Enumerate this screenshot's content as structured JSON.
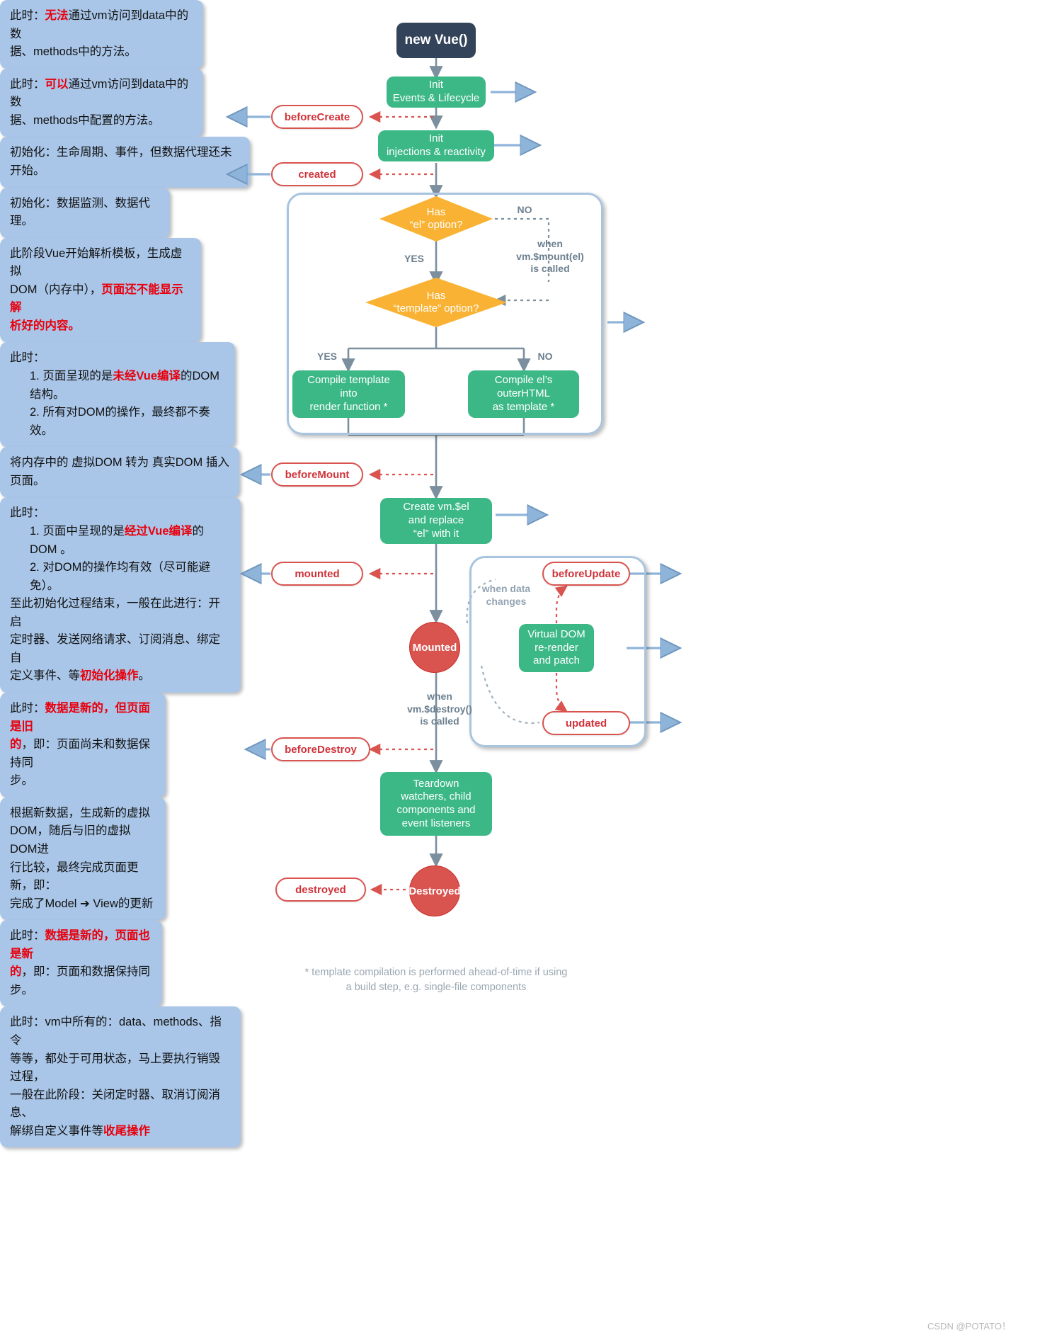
{
  "title": "Vue 生命周期 (Vue Lifecycle Diagram)",
  "nodes": {
    "new_vue": "new Vue()",
    "init_events": "Init\nEvents & Lifecycle",
    "init_injections": "Init\ninjections & reactivity",
    "has_el": "Has\n“el” option?",
    "has_template": "Has\n“template” option?",
    "compile_template": "Compile template\ninto\nrender function *",
    "compile_outer": "Compile el’s\nouterHTML\nas template *",
    "create_el": "Create vm.$el\nand replace\n“el” with it",
    "virtual_dom": "Virtual DOM\nre-render\nand patch",
    "teardown": "Teardown\nwatchers, child\ncomponents and\nevent listeners"
  },
  "hooks": {
    "before_create": "beforeCreate",
    "created": "created",
    "before_mount": "beforeMount",
    "mounted": "mounted",
    "before_update": "beforeUpdate",
    "updated": "updated",
    "before_destroy": "beforeDestroy",
    "destroyed": "destroyed"
  },
  "states": {
    "mounted": "Mounted",
    "destroyed": "Destroyed"
  },
  "edge_labels": {
    "no_1": "NO",
    "yes_1": "YES",
    "when_mount": "when\nvm.$mount(el)\nis called",
    "yes_2": "YES",
    "no_2": "NO",
    "when_data_changes": "when data\nchanges",
    "when_destroy": "when\nvm.$destroy()\nis called"
  },
  "notes": {
    "before_create": {
      "lines": [
        {
          "parts": [
            {
              "t": "此时："
            },
            {
              "t": "无法",
              "hl": true
            },
            {
              "t": "通过vm访问到data中的数"
            }
          ]
        },
        {
          "parts": [
            {
              "t": "据、methods中的方法。"
            }
          ]
        }
      ]
    },
    "created": {
      "lines": [
        {
          "parts": [
            {
              "t": "此时："
            },
            {
              "t": "可以",
              "hl": true
            },
            {
              "t": "通过vm访问到data中的数"
            }
          ]
        },
        {
          "parts": [
            {
              "t": "据、methods中配置的方法。"
            }
          ]
        }
      ]
    },
    "init_events": {
      "lines": [
        {
          "parts": [
            {
              "t": "初始化：生命周期、事件，但数据代理还未开始。"
            }
          ]
        }
      ]
    },
    "init_injections": {
      "lines": [
        {
          "parts": [
            {
              "t": "初始化：数据监测、数据代理。"
            }
          ]
        }
      ]
    },
    "compile_stage": {
      "lines": [
        {
          "parts": [
            {
              "t": "此阶段Vue开始解析模板，生成虚拟"
            }
          ]
        },
        {
          "parts": [
            {
              "t": "DOM（内存中），"
            },
            {
              "t": "页面还不能显示解",
              "hl": true
            }
          ]
        },
        {
          "parts": [
            {
              "t": "析好的内容。",
              "hl": true
            }
          ]
        }
      ]
    },
    "before_mount": {
      "lines": [
        {
          "parts": [
            {
              "t": "此时："
            }
          ]
        },
        {
          "indent": true,
          "parts": [
            {
              "t": "1. 页面呈现的是"
            },
            {
              "t": "未经Vue编译",
              "hl": true
            },
            {
              "t": "的DOM结构。"
            }
          ]
        },
        {
          "indent": true,
          "parts": [
            {
              "t": "2. 所有对DOM的操作，最终都不奏效。"
            }
          ]
        }
      ]
    },
    "create_el": {
      "lines": [
        {
          "parts": [
            {
              "t": "将内存中的 虚拟DOM 转为 真实DOM 插入页面。"
            }
          ]
        }
      ]
    },
    "mounted": {
      "lines": [
        {
          "parts": [
            {
              "t": "此时："
            }
          ]
        },
        {
          "indent": true,
          "parts": [
            {
              "t": "1. 页面中呈现的是"
            },
            {
              "t": "经过Vue编译",
              "hl": true
            },
            {
              "t": "的DOM 。"
            }
          ]
        },
        {
          "indent": true,
          "parts": [
            {
              "t": "2. 对DOM的操作均有效（尽可能避免）。"
            }
          ]
        },
        {
          "parts": [
            {
              "t": "至此初始化过程结束，一般在此进行：开启"
            }
          ]
        },
        {
          "parts": [
            {
              "t": "定时器、发送网络请求、订阅消息、绑定自"
            }
          ]
        },
        {
          "parts": [
            {
              "t": "定义事件、等"
            },
            {
              "t": "初始化操作",
              "hl": true
            },
            {
              "t": "。"
            }
          ]
        }
      ]
    },
    "before_update": {
      "lines": [
        {
          "parts": [
            {
              "t": "此时："
            },
            {
              "t": "数据是新的，但页面是旧",
              "hl": true
            }
          ]
        },
        {
          "parts": [
            {
              "t": "的",
              "hl": true
            },
            {
              "t": "，即：页面尚未和数据保持同"
            }
          ]
        },
        {
          "parts": [
            {
              "t": "步。"
            }
          ]
        }
      ]
    },
    "virtual_dom": {
      "lines": [
        {
          "parts": [
            {
              "t": "根据新数据，生成新的虚拟"
            }
          ]
        },
        {
          "parts": [
            {
              "t": "DOM，随后与旧的虚拟DOM进"
            }
          ]
        },
        {
          "parts": [
            {
              "t": "行比较，最终完成页面更新，即："
            }
          ]
        },
        {
          "parts": [
            {
              "t": "完成了Model ➔ View的更新"
            }
          ]
        }
      ]
    },
    "updated": {
      "lines": [
        {
          "parts": [
            {
              "t": "此时："
            },
            {
              "t": "数据是新的，页面也是新",
              "hl": true
            }
          ]
        },
        {
          "parts": [
            {
              "t": "的",
              "hl": true
            },
            {
              "t": "，即：页面和数据保持同步。"
            }
          ]
        }
      ]
    },
    "before_destroy": {
      "lines": [
        {
          "parts": [
            {
              "t": "此时：vm中所有的：data、methods、指令"
            }
          ]
        },
        {
          "parts": [
            {
              "t": "等等，都处于可用状态，马上要执行销毁过程，"
            }
          ]
        },
        {
          "parts": [
            {
              "t": "一般在此阶段：关闭定时器、取消订阅消息、"
            }
          ]
        },
        {
          "parts": [
            {
              "t": "解绑自定义事件等"
            },
            {
              "t": "收尾操作",
              "hl": true
            }
          ]
        }
      ]
    }
  },
  "footnote": "* template compilation is performed ahead-of-time if using\na build step, e.g. single-file components",
  "watermark": "CSDN @POTATO！",
  "colors": {
    "green": "#3cb887",
    "dark": "#33435a",
    "orange": "#f9b233",
    "red": "#d9534f",
    "note_blue": "#a9c6e8",
    "arrow_blue": "#8fb4da",
    "arrow_gray": "#7b8f9e",
    "highlight": "#e8000d"
  }
}
